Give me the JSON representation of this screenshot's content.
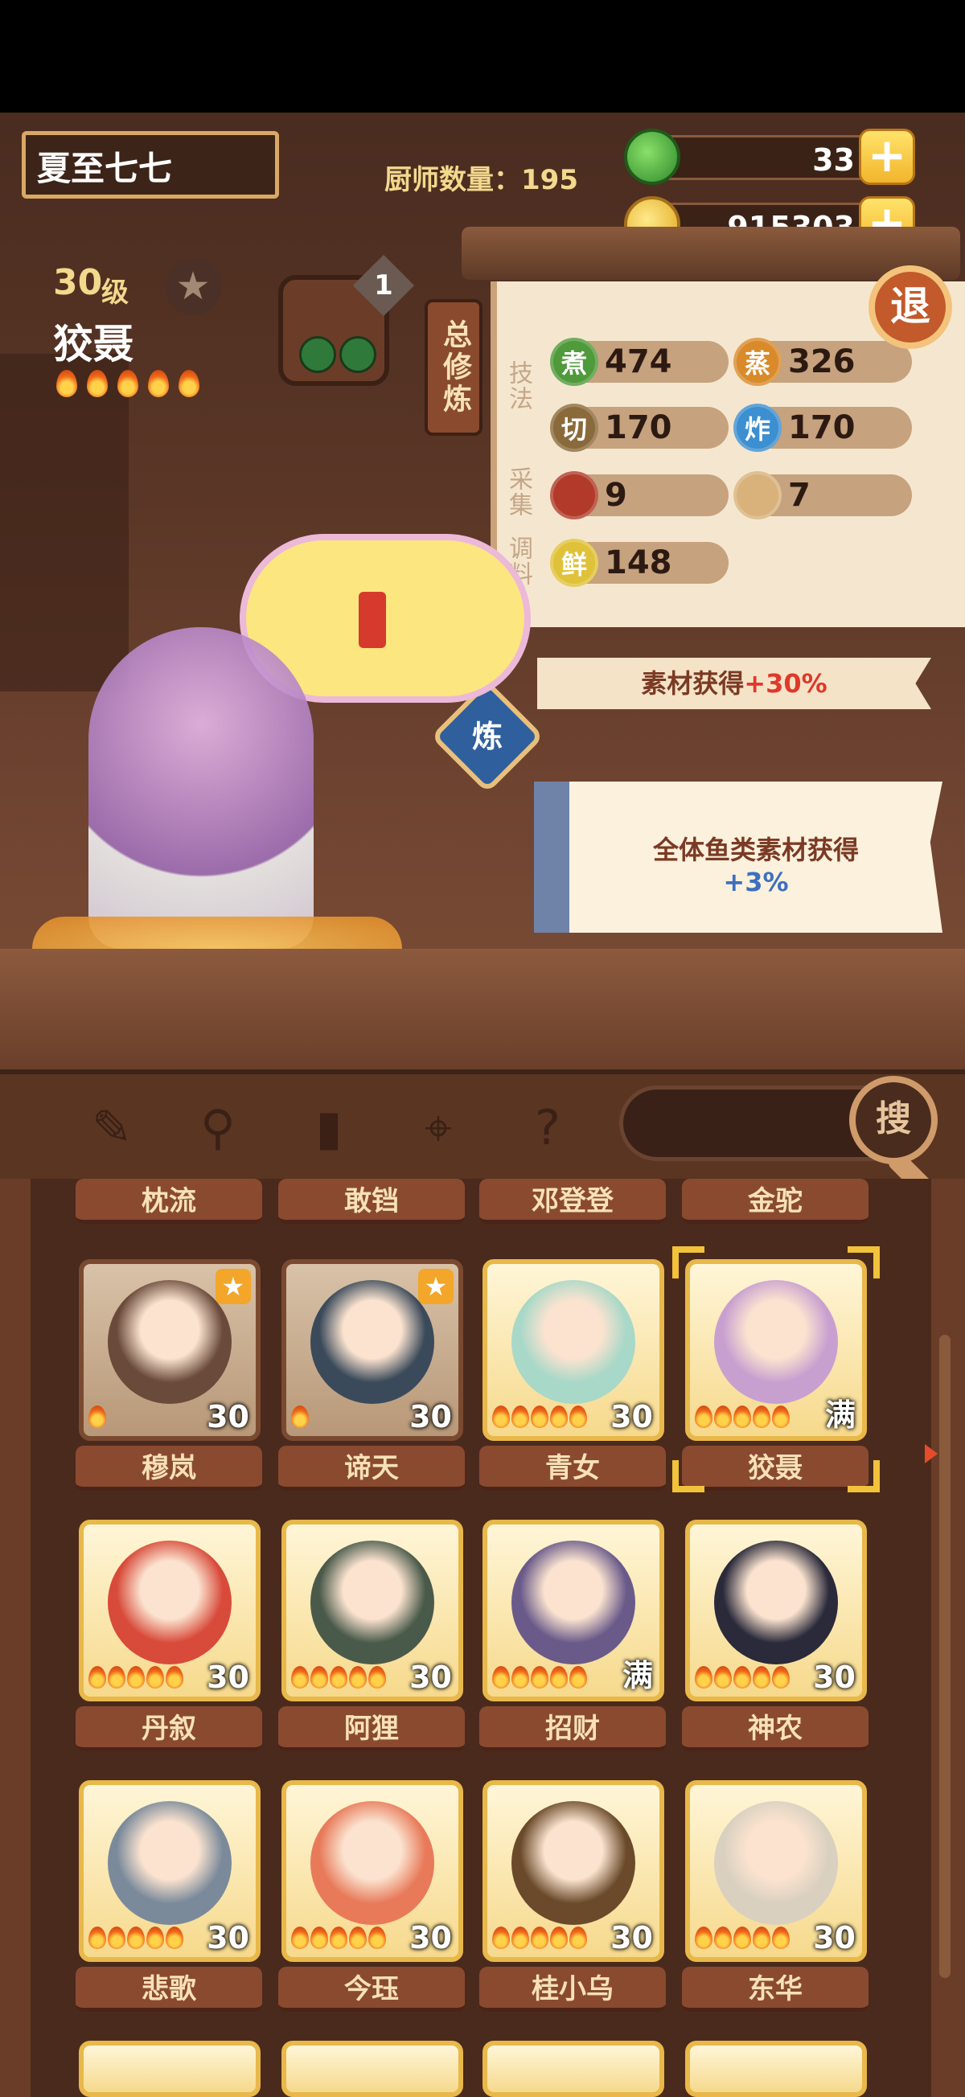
{
  "header": {
    "player_name": "夏至七七",
    "chef_count": "厨师数量：195",
    "jade_amount": "33",
    "gold_amount": "915303",
    "plus_symbol": "+",
    "retire_label": "退"
  },
  "selected_chef": {
    "level_number": "30",
    "level_unit": "级",
    "name": "狡聂",
    "flames": 5,
    "equip_count": "1"
  },
  "panel": {
    "tab_label": "总修炼",
    "sections": {
      "technique": "技法",
      "gather": "采集",
      "seasoning": "调料"
    },
    "stats": {
      "boil": {
        "icon_text": "煮",
        "value": "474",
        "color": "#4f9a3a"
      },
      "steam": {
        "icon_text": "蒸",
        "value": "326",
        "color": "#d98a2a"
      },
      "cut": {
        "icon_text": "切",
        "value": "170",
        "color": "#8a6a3a"
      },
      "fry": {
        "icon_text": "炸",
        "value": "170",
        "color": "#3c8fd0"
      },
      "meat": {
        "value": "9",
        "color": "#b23a2a"
      },
      "veg": {
        "value": "7",
        "color": "#d8b27a"
      },
      "fresh": {
        "icon_text": "鲜",
        "value": "148",
        "color": "#e0c23a"
      }
    }
  },
  "buffs": {
    "refine_label": "炼",
    "buff1_text": "素材获得",
    "buff1_value": "+30%",
    "buff2_text": "全体鱼类素材获得",
    "buff2_value": "+3%"
  },
  "toolbar": {
    "search_label": "搜"
  },
  "roster": {
    "partial_names": [
      "枕流",
      "敢铛",
      "邓登登",
      "金驼"
    ],
    "rows": [
      [
        {
          "name": "穆岚",
          "level": "30",
          "flames": 1,
          "fav": true,
          "frame": "brown",
          "color": "#6a4a3a"
        },
        {
          "name": "谛天",
          "level": "30",
          "flames": 1,
          "fav": true,
          "frame": "brown",
          "color": "#3a4a5a"
        },
        {
          "name": "青女",
          "level": "30",
          "flames": 5,
          "fav": false,
          "frame": "gold",
          "color": "#a8d8c8"
        },
        {
          "name": "狡聂",
          "level": "满",
          "flames": 5,
          "fav": false,
          "frame": "gold",
          "color": "#c8a0d0"
        }
      ],
      [
        {
          "name": "丹叙",
          "level": "30",
          "flames": 5,
          "fav": false,
          "frame": "gold",
          "color": "#d84a3a"
        },
        {
          "name": "阿狸",
          "level": "30",
          "flames": 5,
          "fav": false,
          "frame": "gold",
          "color": "#4a5a4a"
        },
        {
          "name": "招财",
          "level": "满",
          "flames": 5,
          "fav": false,
          "frame": "gold",
          "color": "#6a5a8a"
        },
        {
          "name": "神农",
          "level": "30",
          "flames": 5,
          "fav": false,
          "frame": "gold",
          "color": "#2a2a3a"
        }
      ],
      [
        {
          "name": "悲歌",
          "level": "30",
          "flames": 5,
          "fav": false,
          "frame": "gold",
          "color": "#7a8a9a"
        },
        {
          "name": "今珏",
          "level": "30",
          "flames": 5,
          "fav": false,
          "frame": "gold",
          "color": "#e87a5a"
        },
        {
          "name": "桂小乌",
          "level": "30",
          "flames": 5,
          "fav": false,
          "frame": "gold",
          "color": "#6a4a2a"
        },
        {
          "name": "东华",
          "level": "30",
          "flames": 5,
          "fav": false,
          "frame": "gold",
          "color": "#dad0c0"
        }
      ]
    ]
  }
}
